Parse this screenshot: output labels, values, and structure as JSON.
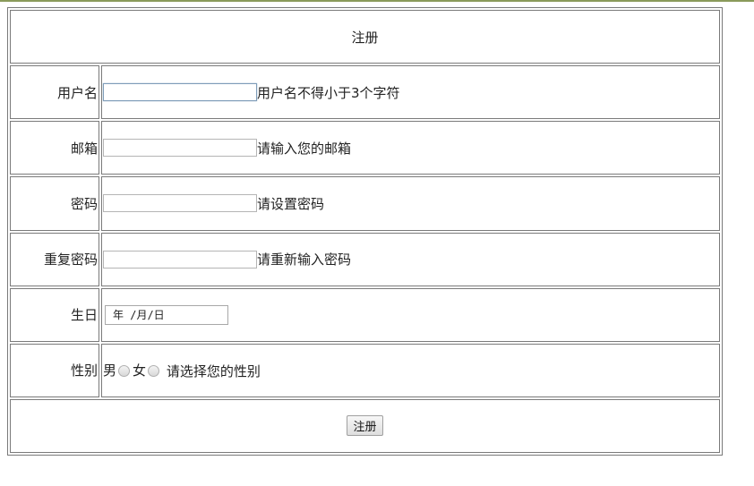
{
  "form": {
    "title": "注册",
    "rows": {
      "username": {
        "label": "用户名",
        "value": "",
        "hint": "用户名不得小于3个字符"
      },
      "email": {
        "label": "邮箱",
        "value": "",
        "hint": "请输入您的邮箱"
      },
      "password": {
        "label": "密码",
        "value": "",
        "hint": "请设置密码"
      },
      "confirm": {
        "label": "重复密码",
        "value": "",
        "hint": "请重新输入密码"
      },
      "birthday": {
        "label": "生日",
        "placeholder": "年 /月/日"
      },
      "gender": {
        "label": "性别",
        "male": "男",
        "female": "女",
        "hint": "请选择您的性别"
      }
    },
    "submit_label": "注册"
  }
}
